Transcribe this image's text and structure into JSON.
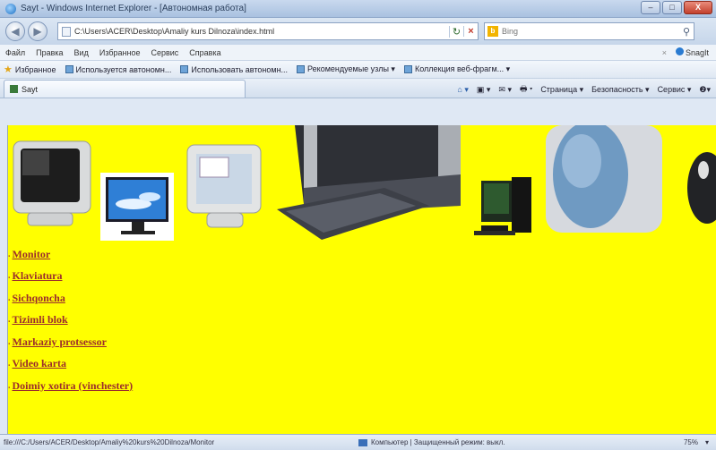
{
  "window": {
    "title": "Sayt - Windows Internet Explorer - [Автономная работа]",
    "min": "–",
    "max": "□",
    "close": "X"
  },
  "address": {
    "url": "C:\\Users\\ACER\\Desktop\\Amaliy kurs Dilnoza\\index.html",
    "refresh": "↻",
    "stop": "×"
  },
  "search": {
    "placeholder": "Bing",
    "engine": "b"
  },
  "menu": {
    "items": [
      "Файл",
      "Правка",
      "Вид",
      "Избранное",
      "Сервис",
      "Справка"
    ],
    "snagit": "SnagIt",
    "close_x": "×"
  },
  "favorites": {
    "label": "Избранное",
    "items": [
      "Используется автономн...",
      "Использовать автономн...",
      "Рекомендуемые узлы ▾",
      "Коллекция веб-фрагм... ▾"
    ]
  },
  "tab": {
    "title": "Sayt"
  },
  "commands": {
    "home": "⌂ ▾",
    "feeds": "▣ ▾",
    "mail": "✉ ▾",
    "print": "🖶 ▾",
    "page": "Страница ▾",
    "safety": "Безопасность ▾",
    "tools": "Сервис ▾",
    "help": "❷▾"
  },
  "content": {
    "bg_color": "#ffff00",
    "link_color": "#9b2c2c",
    "links": [
      "Monitor",
      "Klaviatura",
      "Sichqoncha",
      "Tizimli blok",
      "Markaziy protsessor",
      "Video karta",
      "Doimiy xotira (vinchester)"
    ]
  },
  "status": {
    "url": "file:///C:/Users/ACER/Desktop/Amaliy%20kurs%20Dilnoza/Monitor",
    "zone": "Компьютер | Защищенный режим: выкл.",
    "zoom": "75%",
    "zoom_menu": "▾"
  }
}
